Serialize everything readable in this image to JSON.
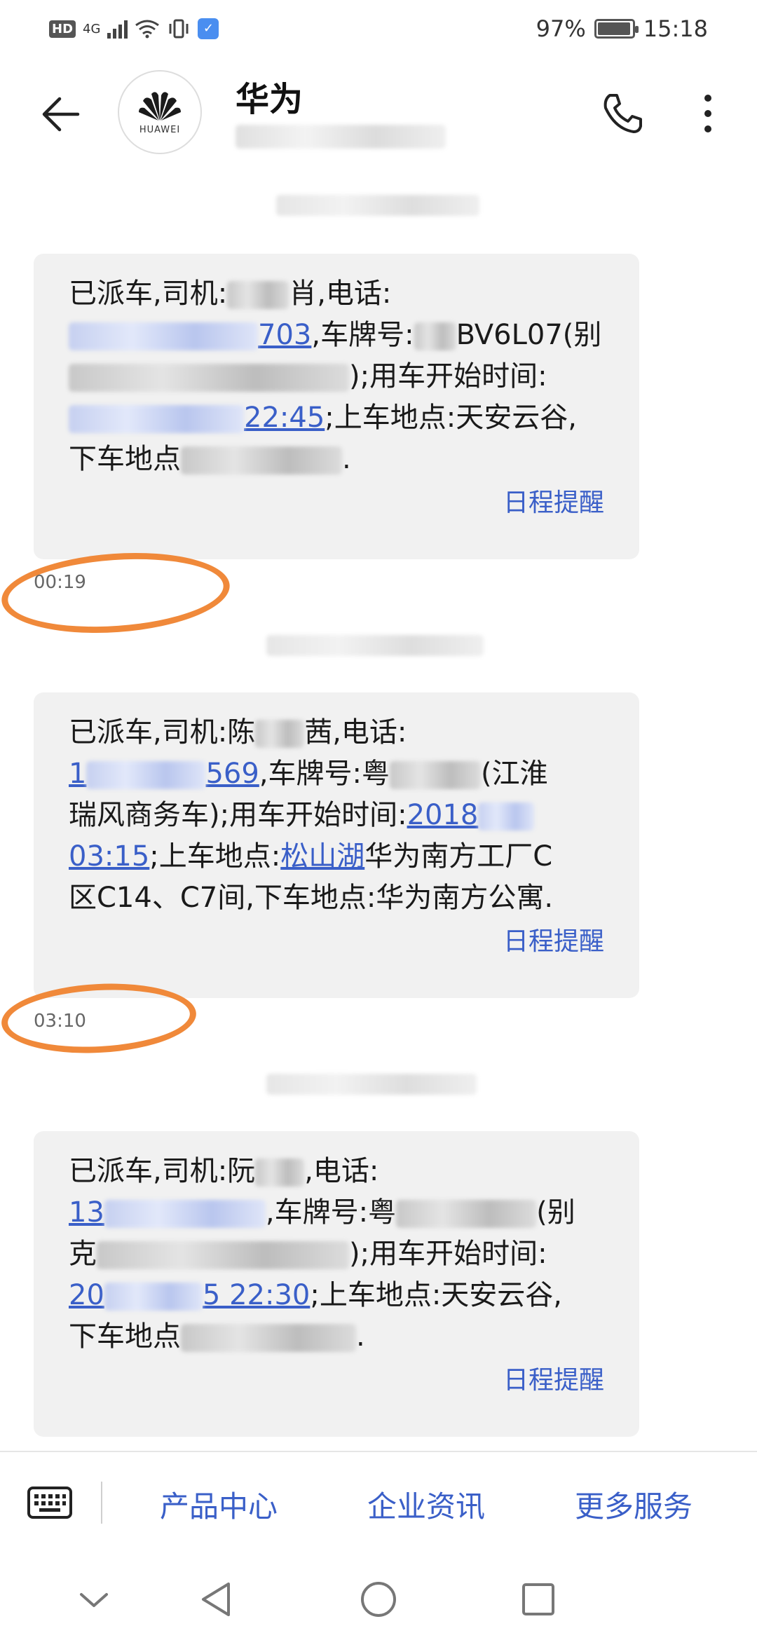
{
  "status_bar": {
    "left_hd": "HD",
    "left_network": "4G",
    "battery_percent": "97%",
    "battery_level": 0.97,
    "time": "15:18"
  },
  "header": {
    "contact_name": "华为",
    "avatar_brand": "HUAWEI"
  },
  "messages": [
    {
      "time": "00:19",
      "reminder_label": "日程提醒",
      "segments": {
        "s1": "已派车,司机:",
        "s2": "肖,电话:",
        "s3": "703",
        "s4": ",车牌号:",
        "s5": "BV6L07(别",
        "s6": ");用车开始时间:",
        "s7": "22:45",
        "s8": ";上车地点:天安云谷,",
        "s9": "下车地点",
        "s10": "."
      }
    },
    {
      "time": "03:10",
      "reminder_label": "日程提醒",
      "segments": {
        "s1": "已派车,司机:陈",
        "s2": "茜,电话:",
        "s3": "1",
        "s4": "569",
        "s5": ",车牌号:粤",
        "s6": "(江淮",
        "s7": "瑞风商务车);用车开始时间:",
        "s8": "2018",
        "s9": "03:15",
        "s10": ";上车地点:",
        "s11": "松山湖",
        "s12": "华为南方工厂C",
        "s13": "区C14、C7间,下车地点:华为南方公寓."
      }
    },
    {
      "reminder_label": "日程提醒",
      "segments": {
        "s1": "已派车,司机:阮",
        "s2": ",电话:",
        "s3": "13",
        "s4": ",车牌号:粤",
        "s5": "(别",
        "s6": "克",
        "s7": ");用车开始时间:",
        "s8": "20",
        "s9": "5 22:30",
        "s10": ";上车地点:天安云谷,",
        "s11": "下车地点",
        "s12": "."
      }
    }
  ],
  "menu": {
    "items": [
      "产品中心",
      "企业资讯",
      "更多服务"
    ]
  },
  "colors": {
    "link_blue": "#3a5fc8",
    "bubble_bg": "#f1f1f1",
    "annotation_orange": "#f0893a"
  }
}
